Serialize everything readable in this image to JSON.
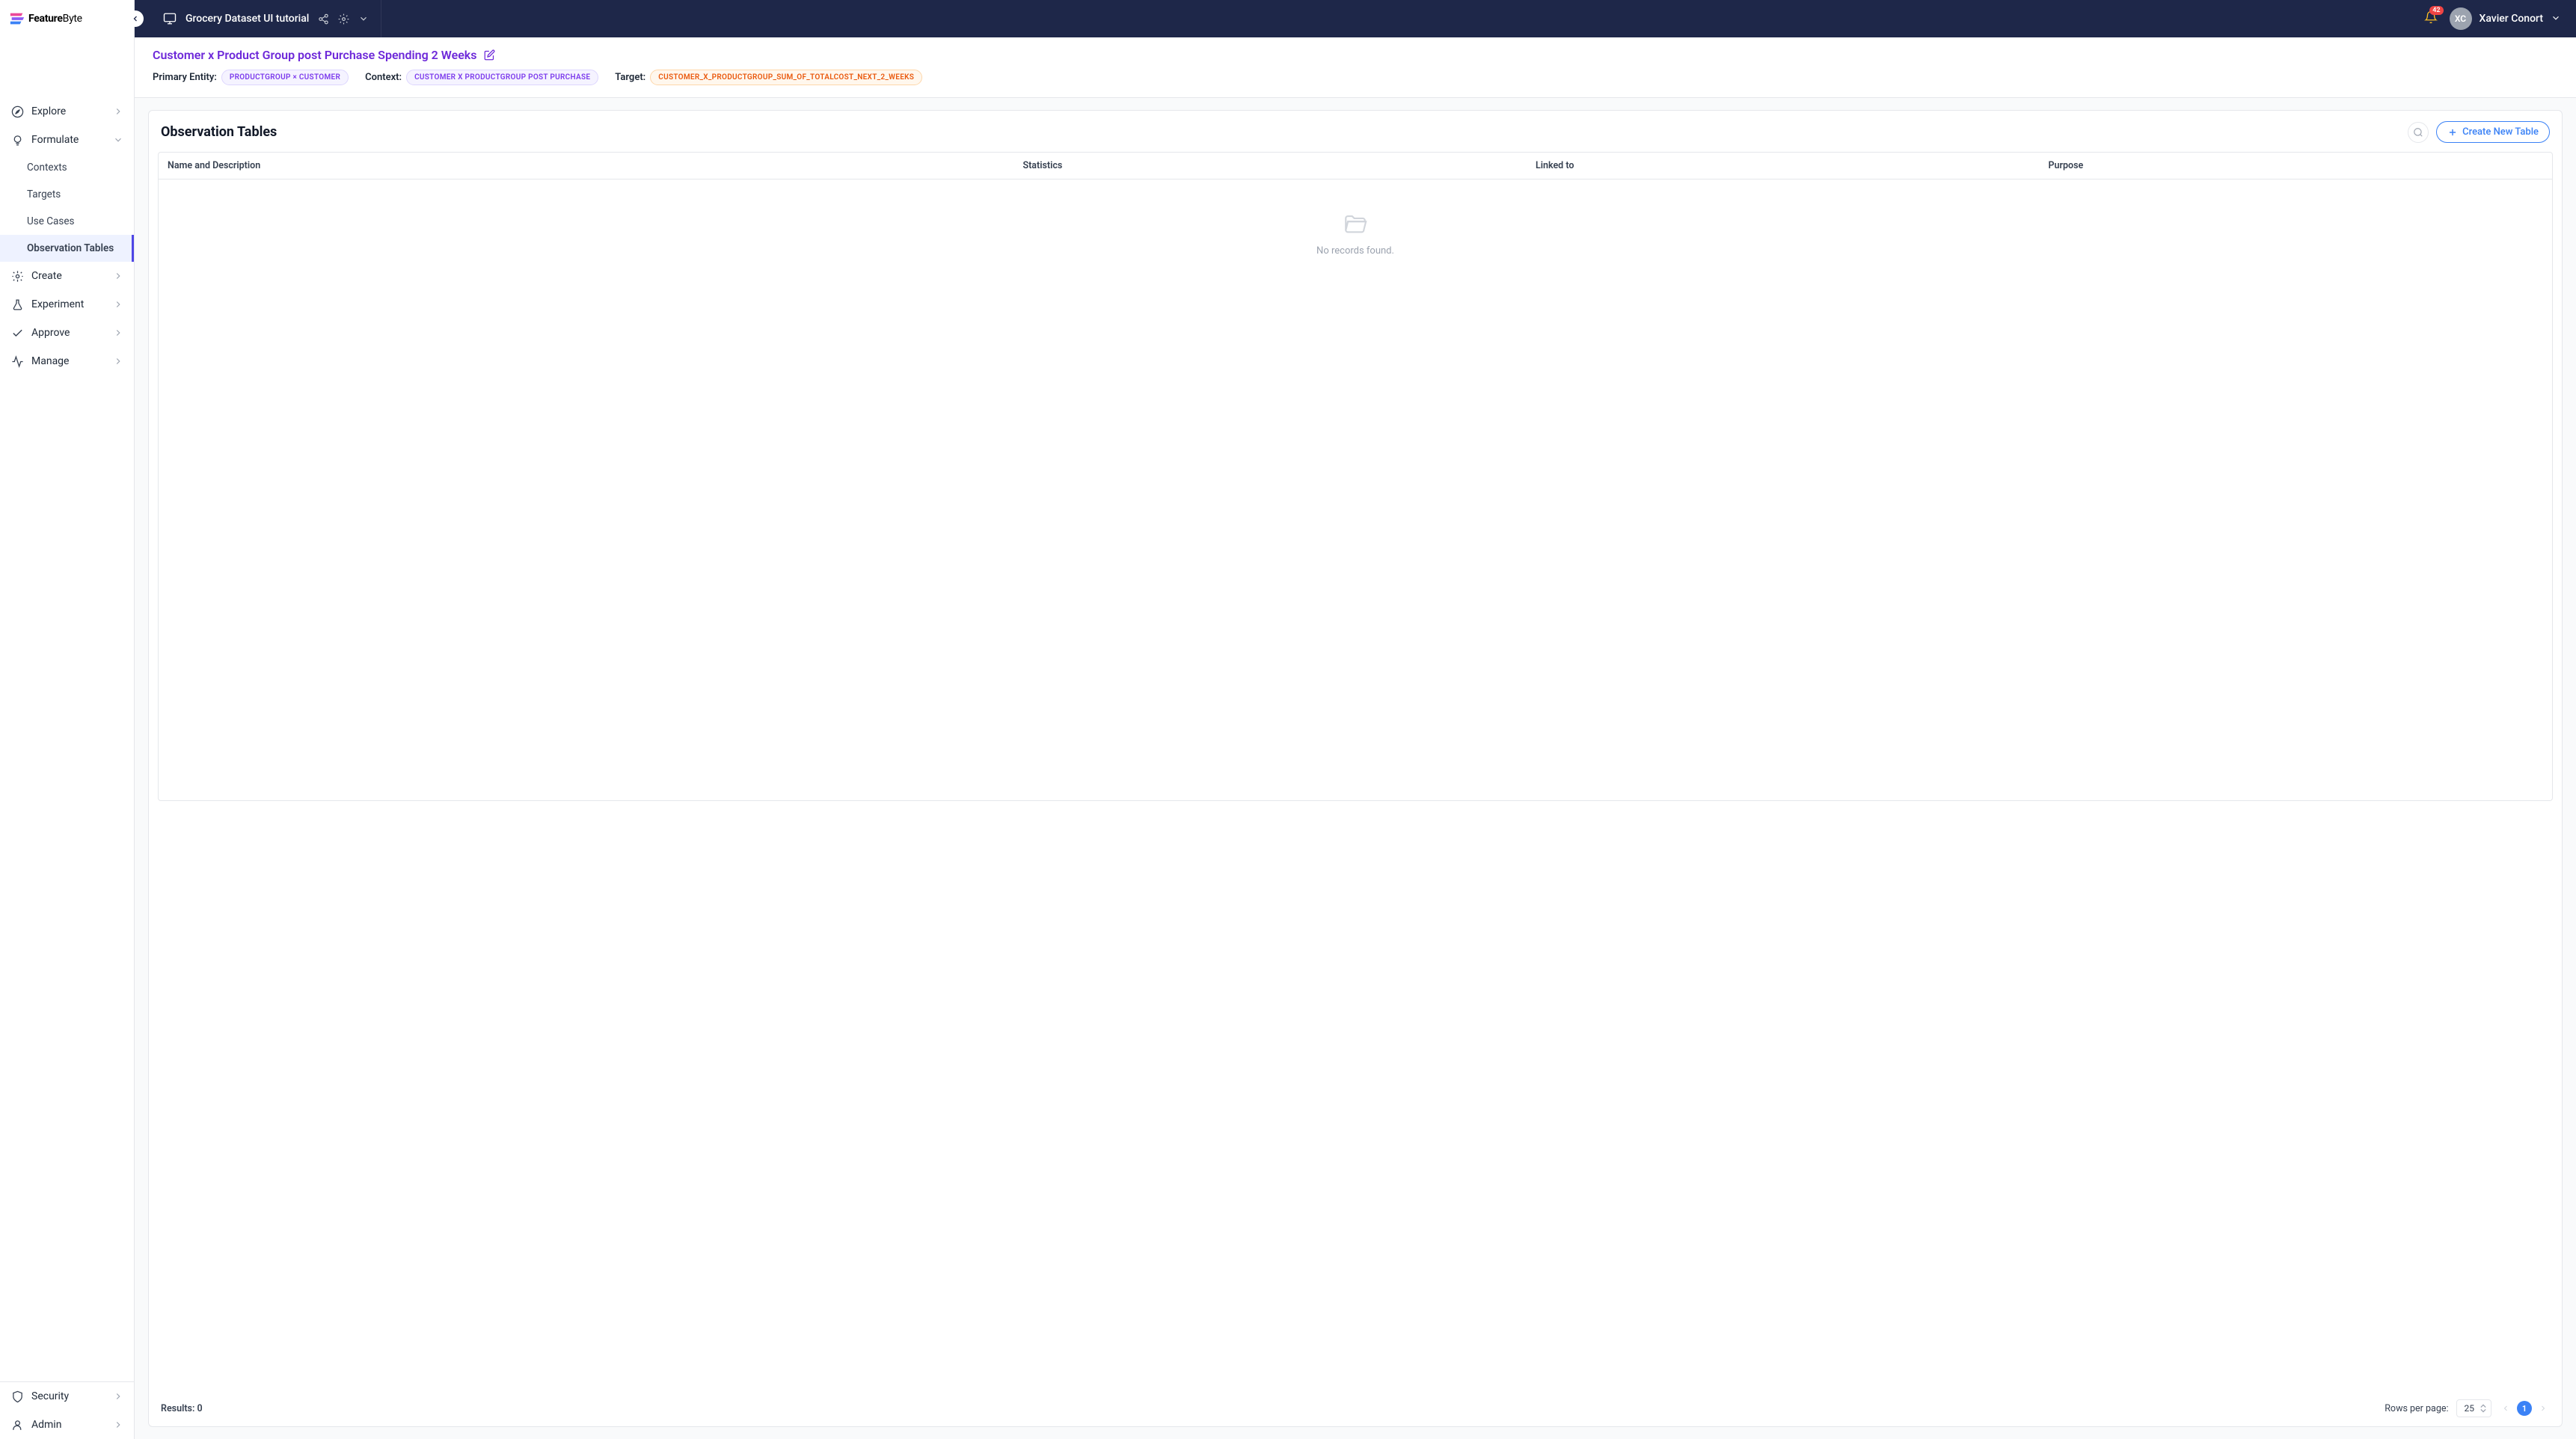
{
  "brand": {
    "name_bold": "Feature",
    "name_light": "Byte"
  },
  "topbar": {
    "workspace_name": "Grocery Dataset UI tutorial",
    "notification_count": "42",
    "user_initials": "XC",
    "user_name": "Xavier Conort"
  },
  "sidebar": {
    "main": [
      {
        "label": "Explore",
        "icon": "compass",
        "expanded": false
      },
      {
        "label": "Formulate",
        "icon": "bulb",
        "expanded": true,
        "children": [
          {
            "label": "Contexts",
            "active": false
          },
          {
            "label": "Targets",
            "active": false
          },
          {
            "label": "Use Cases",
            "active": false
          },
          {
            "label": "Observation Tables",
            "active": true
          }
        ]
      },
      {
        "label": "Create",
        "icon": "sparkle",
        "expanded": false
      },
      {
        "label": "Experiment",
        "icon": "flask",
        "expanded": false
      },
      {
        "label": "Approve",
        "icon": "check",
        "expanded": false
      },
      {
        "label": "Manage",
        "icon": "activity",
        "expanded": false
      }
    ],
    "bottom": [
      {
        "label": "Security",
        "icon": "shield"
      },
      {
        "label": "Admin",
        "icon": "user"
      }
    ]
  },
  "header": {
    "title": "Customer x Product Group post Purchase Spending 2 Weeks",
    "primary_entity_label": "Primary Entity:",
    "primary_entity_value": "PRODUCTGROUP × CUSTOMER",
    "context_label": "Context:",
    "context_value": "CUSTOMER X PRODUCTGROUP POST PURCHASE",
    "target_label": "Target:",
    "target_value": "CUSTOMER_X_PRODUCTGROUP_SUM_OF_TOTALCOST_NEXT_2_WEEKS"
  },
  "content": {
    "section_title": "Observation Tables",
    "create_button": "Create New Table",
    "columns": {
      "name": "Name and Description",
      "statistics": "Statistics",
      "linked": "Linked to",
      "purpose": "Purpose"
    },
    "empty_message": "No records found."
  },
  "footer": {
    "results_label": "Results:",
    "results_count": "0",
    "rows_label": "Rows per page:",
    "rows_value": "25",
    "current_page": "1"
  }
}
